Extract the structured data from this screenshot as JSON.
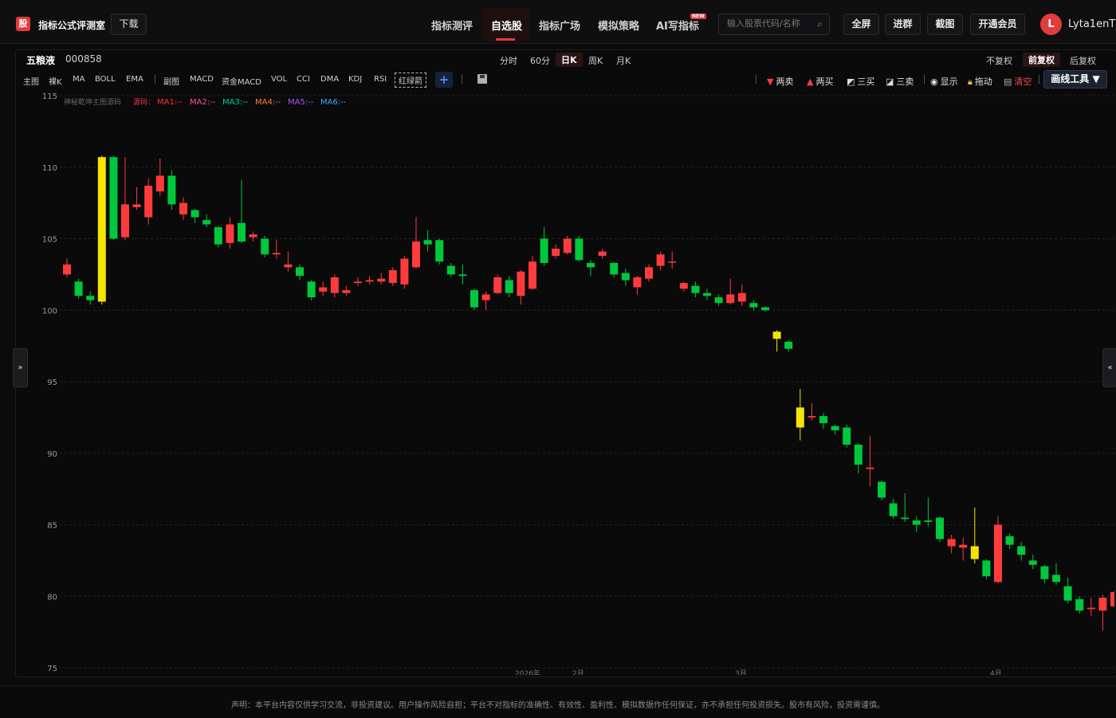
{
  "app": {
    "logo": "股",
    "title": "指标公式评测室",
    "download": "下载"
  },
  "nav": {
    "items": [
      "指标测评",
      "自选股",
      "指标广场",
      "模拟策略",
      "AI写指标"
    ],
    "active": "自选股",
    "new_badge": "NEW"
  },
  "search": {
    "placeholder": "输入股票代码/名称",
    "icon": "search-icon"
  },
  "header_actions": [
    "全屏",
    "进群",
    "截图",
    "开通会员"
  ],
  "user": {
    "initial": "L",
    "name": "Lyta1enT"
  },
  "stock": {
    "name": "五粮液",
    "code": "000858"
  },
  "periods": [
    "分时",
    "60分",
    "日K",
    "周K",
    "月K"
  ],
  "period_active": "日K",
  "adjust": [
    "不复权",
    "前复权",
    "后复权"
  ],
  "adjust_active": "前复权",
  "indicators": [
    "主图",
    "裸K",
    "MA",
    "BOLL",
    "EMA",
    "副图",
    "MACD",
    "资金MACD",
    "VOL",
    "CCI",
    "DMA",
    "KDJ",
    "RSI",
    "红绿箭"
  ],
  "tools": {
    "sell2": "两卖",
    "buy2": "两买",
    "buy3": "三买",
    "sell3": "三卖",
    "show": "显示",
    "drag": "拖动",
    "clear": "清空",
    "draw": "画线工具 ▼"
  },
  "legend": {
    "source": "神秘乾坤主图源码",
    "note": "源码：",
    "ma": [
      "MA1:--",
      "MA2:--",
      "MA3:--",
      "MA4:--",
      "MA5:--",
      "MA6:--"
    ]
  },
  "side_tabs": {
    "left": "»",
    "right": "«"
  },
  "disclaimer": "声明：本平台内容仅供学习交流，非投资建议。用户操作风险自担；平台不对指标的准确性、有效性、盈利性、模拟数据作任何保证，亦不承担任何投资损失。股市有风险，投资需谨慎。",
  "colors": {
    "up": "#ff3b3b",
    "down": "#00c83c",
    "signal": "#f5e400",
    "accent": "#e23b3b"
  },
  "chart_data": {
    "type": "candlestick",
    "title": "",
    "ylim": [
      75,
      115
    ],
    "yticks": [
      75,
      80,
      85,
      90,
      95,
      100,
      105,
      110,
      115
    ],
    "xticks": [
      "2026年",
      "2月",
      "3月",
      "4月"
    ],
    "candles": [
      {
        "o": 102.5,
        "c": 103.2,
        "h": 103.6,
        "l": 102.3
      },
      {
        "o": 102.0,
        "c": 101.0,
        "h": 102.2,
        "l": 100.8
      },
      {
        "o": 101.0,
        "c": 100.7,
        "h": 101.3,
        "l": 100.4
      },
      {
        "o": 100.6,
        "c": 110.7,
        "h": 110.8,
        "l": 100.4,
        "y": 1
      },
      {
        "o": 110.7,
        "c": 105.0,
        "h": 110.8,
        "l": 104.9
      },
      {
        "o": 105.1,
        "c": 107.4,
        "h": 110.7,
        "l": 104.9
      },
      {
        "o": 107.2,
        "c": 107.4,
        "h": 108.6,
        "l": 107.0
      },
      {
        "o": 106.5,
        "c": 108.7,
        "h": 109.2,
        "l": 106.0
      },
      {
        "o": 108.3,
        "c": 109.4,
        "h": 110.6,
        "l": 108.0
      },
      {
        "o": 109.4,
        "c": 107.4,
        "h": 109.8,
        "l": 107.0
      },
      {
        "o": 106.7,
        "c": 107.5,
        "h": 107.9,
        "l": 106.3
      },
      {
        "o": 107.0,
        "c": 106.5,
        "h": 107.1,
        "l": 106.1
      },
      {
        "o": 106.3,
        "c": 106.0,
        "h": 106.7,
        "l": 105.8
      },
      {
        "o": 105.8,
        "c": 104.6,
        "h": 105.9,
        "l": 104.4
      },
      {
        "o": 104.7,
        "c": 106.0,
        "h": 106.5,
        "l": 104.3
      },
      {
        "o": 106.1,
        "c": 104.8,
        "h": 109.1,
        "l": 104.7
      },
      {
        "o": 105.1,
        "c": 105.3,
        "h": 105.5,
        "l": 104.8
      },
      {
        "o": 105.0,
        "c": 103.9,
        "h": 105.2,
        "l": 103.7
      },
      {
        "o": 103.9,
        "c": 104.0,
        "h": 104.9,
        "l": 103.6
      },
      {
        "o": 103.0,
        "c": 103.2,
        "h": 104.1,
        "l": 102.7
      },
      {
        "o": 103.0,
        "c": 102.4,
        "h": 103.2,
        "l": 102.1
      },
      {
        "o": 102.0,
        "c": 100.9,
        "h": 102.1,
        "l": 100.7
      },
      {
        "o": 101.3,
        "c": 101.6,
        "h": 102.0,
        "l": 101.0
      },
      {
        "o": 101.2,
        "c": 102.3,
        "h": 102.5,
        "l": 100.9
      },
      {
        "o": 101.2,
        "c": 101.4,
        "h": 101.7,
        "l": 101.0
      },
      {
        "o": 101.9,
        "c": 102.0,
        "h": 102.3,
        "l": 101.7
      },
      {
        "o": 102.0,
        "c": 102.1,
        "h": 102.4,
        "l": 101.8
      },
      {
        "o": 102.0,
        "c": 102.2,
        "h": 102.6,
        "l": 101.8
      },
      {
        "o": 101.9,
        "c": 102.8,
        "h": 103.0,
        "l": 101.7
      },
      {
        "o": 101.8,
        "c": 103.6,
        "h": 103.8,
        "l": 101.5
      },
      {
        "o": 103.0,
        "c": 104.8,
        "h": 106.5,
        "l": 102.9
      },
      {
        "o": 104.9,
        "c": 104.6,
        "h": 105.6,
        "l": 104.1
      },
      {
        "o": 104.9,
        "c": 103.4,
        "h": 105.0,
        "l": 103.2
      },
      {
        "o": 103.1,
        "c": 102.5,
        "h": 103.3,
        "l": 102.3
      },
      {
        "o": 102.5,
        "c": 102.4,
        "h": 103.2,
        "l": 101.8
      },
      {
        "o": 101.4,
        "c": 100.2,
        "h": 101.5,
        "l": 100.0
      },
      {
        "o": 100.7,
        "c": 101.1,
        "h": 101.3,
        "l": 100.0
      },
      {
        "o": 101.2,
        "c": 102.3,
        "h": 102.5,
        "l": 101.1
      },
      {
        "o": 102.1,
        "c": 101.2,
        "h": 102.4,
        "l": 100.9
      },
      {
        "o": 101.0,
        "c": 102.7,
        "h": 102.8,
        "l": 100.4
      },
      {
        "o": 101.5,
        "c": 103.4,
        "h": 103.8,
        "l": 101.4
      },
      {
        "o": 105.0,
        "c": 103.3,
        "h": 105.8,
        "l": 103.1
      },
      {
        "o": 103.8,
        "c": 104.3,
        "h": 104.6,
        "l": 103.6
      },
      {
        "o": 104.0,
        "c": 105.0,
        "h": 105.2,
        "l": 103.9
      },
      {
        "o": 105.0,
        "c": 103.5,
        "h": 105.2,
        "l": 103.4
      },
      {
        "o": 103.3,
        "c": 103.0,
        "h": 103.5,
        "l": 102.4
      },
      {
        "o": 103.8,
        "c": 104.1,
        "h": 104.3,
        "l": 103.6
      },
      {
        "o": 103.3,
        "c": 102.5,
        "h": 103.4,
        "l": 102.3
      },
      {
        "o": 102.6,
        "c": 102.1,
        "h": 102.9,
        "l": 101.7
      },
      {
        "o": 101.6,
        "c": 102.3,
        "h": 102.4,
        "l": 101.1
      },
      {
        "o": 102.2,
        "c": 103.0,
        "h": 103.2,
        "l": 102.0
      },
      {
        "o": 103.1,
        "c": 103.9,
        "h": 104.1,
        "l": 102.8
      },
      {
        "o": 103.4,
        "c": 103.4,
        "h": 104.1,
        "l": 102.9
      },
      {
        "o": 101.5,
        "c": 101.9,
        "h": 102.0,
        "l": 101.3
      },
      {
        "o": 101.7,
        "c": 101.2,
        "h": 102.0,
        "l": 100.9
      },
      {
        "o": 101.2,
        "c": 101.0,
        "h": 101.5,
        "l": 100.7
      },
      {
        "o": 100.9,
        "c": 100.5,
        "h": 101.1,
        "l": 100.3
      },
      {
        "o": 100.5,
        "c": 101.1,
        "h": 102.2,
        "l": 100.4
      },
      {
        "o": 100.6,
        "c": 101.2,
        "h": 101.8,
        "l": 100.3
      },
      {
        "o": 100.5,
        "c": 100.2,
        "h": 100.7,
        "l": 100.0
      },
      {
        "o": 100.2,
        "c": 100.0,
        "h": 100.3,
        "l": 99.9
      },
      {
        "o": 98.5,
        "c": 98.0,
        "h": 98.6,
        "l": 97.1,
        "y": 1
      },
      {
        "o": 97.8,
        "c": 97.3,
        "h": 97.9,
        "l": 97.1
      },
      {
        "o": 91.8,
        "c": 93.2,
        "h": 94.5,
        "l": 90.9,
        "y": 1
      },
      {
        "o": 92.5,
        "c": 92.6,
        "h": 93.5,
        "l": 92.3
      },
      {
        "o": 92.6,
        "c": 92.1,
        "h": 92.8,
        "l": 91.7
      },
      {
        "o": 91.9,
        "c": 91.6,
        "h": 92.0,
        "l": 91.3
      },
      {
        "o": 91.8,
        "c": 90.6,
        "h": 92.0,
        "l": 90.4
      },
      {
        "o": 90.6,
        "c": 89.2,
        "h": 90.7,
        "l": 88.6
      },
      {
        "o": 88.9,
        "c": 89.0,
        "h": 91.2,
        "l": 87.7
      },
      {
        "o": 88.0,
        "c": 86.9,
        "h": 88.1,
        "l": 86.7
      },
      {
        "o": 86.5,
        "c": 85.6,
        "h": 86.8,
        "l": 85.4
      },
      {
        "o": 85.5,
        "c": 85.4,
        "h": 87.2,
        "l": 85.2
      },
      {
        "o": 85.3,
        "c": 85.0,
        "h": 85.6,
        "l": 84.5
      },
      {
        "o": 85.3,
        "c": 85.2,
        "h": 86.9,
        "l": 84.9
      },
      {
        "o": 85.5,
        "c": 84.0,
        "h": 85.6,
        "l": 83.8
      },
      {
        "o": 83.5,
        "c": 84.0,
        "h": 84.3,
        "l": 83.0
      },
      {
        "o": 83.4,
        "c": 83.6,
        "h": 84.1,
        "l": 82.5
      },
      {
        "o": 82.6,
        "c": 83.5,
        "h": 86.2,
        "l": 82.3,
        "y": 1
      },
      {
        "o": 82.5,
        "c": 81.4,
        "h": 82.6,
        "l": 81.2
      },
      {
        "o": 81.0,
        "c": 85.0,
        "h": 85.6,
        "l": 80.9
      },
      {
        "o": 84.2,
        "c": 83.6,
        "h": 84.4,
        "l": 83.3
      },
      {
        "o": 83.5,
        "c": 82.9,
        "h": 83.8,
        "l": 82.5
      },
      {
        "o": 82.5,
        "c": 82.2,
        "h": 82.9,
        "l": 81.9
      },
      {
        "o": 82.1,
        "c": 81.2,
        "h": 82.2,
        "l": 80.9
      },
      {
        "o": 81.5,
        "c": 81.0,
        "h": 82.3,
        "l": 80.8
      },
      {
        "o": 80.7,
        "c": 79.7,
        "h": 81.3,
        "l": 79.5
      },
      {
        "o": 79.8,
        "c": 79.0,
        "h": 80.0,
        "l": 78.8
      },
      {
        "o": 79.1,
        "c": 79.2,
        "h": 79.9,
        "l": 78.6
      },
      {
        "o": 79.0,
        "c": 79.9,
        "h": 80.1,
        "l": 77.6
      },
      {
        "o": 79.3,
        "c": 80.3,
        "h": 80.4,
        "l": 79.2
      }
    ]
  }
}
